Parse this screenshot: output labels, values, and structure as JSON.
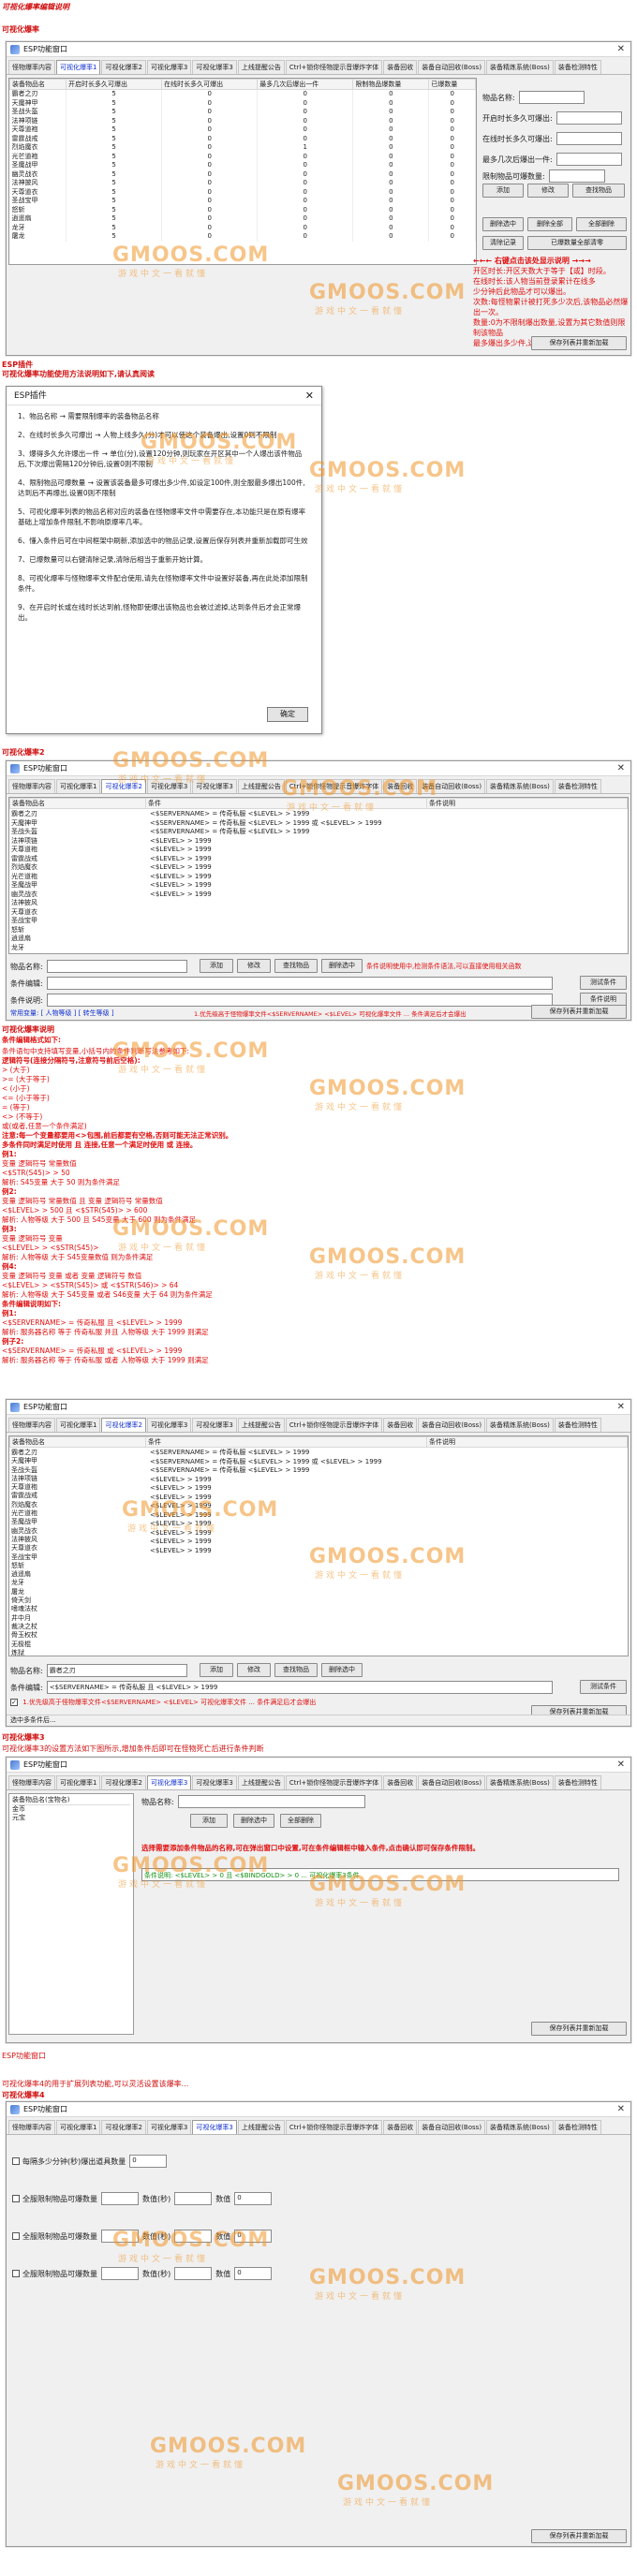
{
  "page_title": "可视化爆率编辑说明",
  "s1": {
    "label": "可视化爆率",
    "window_title": "ESP功能窗口",
    "tabs": [
      "怪物爆率内容",
      "可视化爆率1",
      "可视化爆率2",
      "可视化爆率3",
      "可视化爆率3",
      "上线提醒公告",
      "Ctrl+锁你怪物提示音爆炸字体",
      "装备回收",
      "装备自动回收(Boss)",
      "装备精炼系统(Boss)",
      "装备检测特性"
    ],
    "active_tab": 1,
    "grid_headers": [
      "装备物品名",
      "开启时长多久可爆出",
      "在线时长多久可爆出",
      "最多几次后爆出一件",
      "限制物品爆数量",
      "已爆数量"
    ],
    "grid_rows": [
      [
        "霸者之刃",
        "5",
        "0",
        "0",
        "0",
        "0"
      ],
      [
        "天魔神甲",
        "5",
        "0",
        "0",
        "0",
        "0"
      ],
      [
        "圣战头盔",
        "5",
        "0",
        "0",
        "0",
        "0"
      ],
      [
        "法神项链",
        "5",
        "0",
        "0",
        "0",
        "0"
      ],
      [
        "天尊道袍",
        "5",
        "0",
        "0",
        "0",
        "0"
      ],
      [
        "雷霆战戒",
        "5",
        "0",
        "0",
        "0",
        "0"
      ],
      [
        "烈焰魔衣",
        "5",
        "0",
        "1",
        "0",
        "0"
      ],
      [
        "光芒道袍",
        "5",
        "0",
        "0",
        "0",
        "0"
      ],
      [
        "圣魔战甲",
        "5",
        "0",
        "0",
        "0",
        "0"
      ],
      [
        "幽灵战衣",
        "5",
        "0",
        "0",
        "0",
        "0"
      ],
      [
        "法神披风",
        "5",
        "0",
        "0",
        "0",
        "0"
      ],
      [
        "天尊道衣",
        "5",
        "0",
        "0",
        "0",
        "0"
      ],
      [
        "圣战宝甲",
        "5",
        "0",
        "0",
        "0",
        "0"
      ],
      [
        "怒斩",
        "5",
        "0",
        "0",
        "0",
        "0"
      ],
      [
        "逍遥扇",
        "5",
        "0",
        "0",
        "0",
        "0"
      ],
      [
        "龙牙",
        "5",
        "0",
        "0",
        "0",
        "0"
      ],
      [
        "屠龙",
        "5",
        "0",
        "0",
        "0",
        "0"
      ]
    ],
    "form_labels": [
      "物品名称:",
      "开启时长多久可爆出:",
      "在线时长多久可爆出:",
      "最多几次后爆出一件:",
      "限制物品可爆数量:"
    ],
    "buttons": {
      "add": "添加",
      "modify": "修改",
      "query": "查找物品",
      "delete_selected": "删除选中",
      "delete_all": "删除全部",
      "full_delete": "全部删除",
      "clear_record": "清除记录",
      "clear_all": "已爆数量全部清零",
      "save": "保存列表并重新加载"
    },
    "notes": [
      "←←← 右键点击该处显示说明 →→→",
      "开区时长:开区天数大于等于【或】时段。",
      "在线时长:该人物当前登录累计在线多",
      "少分钟后此物品才可以爆出。",
      "次数:每怪物累计被打死多少次后,该物品必然爆出一次。",
      "数量:0为不限制爆出数量,设置为其它数值则限制该物品",
      "最多爆出多少件,达到数量后不再爆出。"
    ]
  },
  "s2": {
    "label": "ESP插件",
    "note": "可视化爆率功能使用方法说明如下,请认真阅读",
    "popup_title": "ESP插件",
    "popup_paras": [
      "1、物品名称 → 需要限制爆率的装备物品名称",
      "2、在线时长多久可爆出 → 人物上线多久(分)才可以使这个装备爆出,设置0则不限制",
      "3、爆得多久允许爆出一件 → 单位(分),设置120分钟,则玩家在开区其中一个人爆出该件物品后,下次爆出需隔120分钟后,设置0则不限制",
      "4、限制物品可爆数量 → 设置该装备最多可爆出多少件,如设定100件,则全服最多爆出100件,达到后不再爆出,设置0则不限制",
      "5、可视化爆率列表的物品名称对应的装备在怪物爆率文件中需要存在,本功能只是在原有爆率基础上增加条件限制,不影响原爆率几率。",
      "6、懂入条件后可在中间框架中刷新,添加选中的物品记录,设置后保存列表并重新加载即可生效",
      "7、已爆数量可以右键清除记录,清除后相当于重新开始计算。",
      "8、可视化爆率与怪物爆率文件配合使用,请先在怪物爆率文件中设置好装备,再在此处添加限制条件。",
      "9、在开启时长或在线时长达到前,怪物即使爆出该物品也会被过滤掉,达到条件后才会正常爆出。"
    ],
    "ok": "确定"
  },
  "s3": {
    "label": "可视化爆率2",
    "window_title": "ESP功能窗口",
    "active_tab": 2,
    "grid_headers": [
      "装备物品名",
      "条件",
      "条件说明"
    ],
    "left_items": [
      "霸者之刃",
      "天魔神甲",
      "圣战头盔",
      "法神项链",
      "天尊道袍",
      "雷霆战戒",
      "烈焰魔衣",
      "光芒道袍",
      "圣魔战甲",
      "幽灵战衣",
      "法神披风",
      "天尊道衣",
      "圣战宝甲",
      "怒斩",
      "逍遥扇",
      "龙牙"
    ],
    "cond_lines": [
      "<$SERVERNAME> = 传奇私服 <$LEVEL> > 1999",
      "<$SERVERNAME> = 传奇私服 <$LEVEL> > 1999 或 <$LEVEL> > 1999",
      "<$SERVERNAME> = 传奇私服 <$LEVEL> > 1999",
      "<$LEVEL> > 1999",
      "<$LEVEL> > 1999",
      "<$LEVEL> > 1999",
      "<$LEVEL> > 1999",
      "<$LEVEL> > 1999",
      "<$LEVEL> > 1999",
      "<$LEVEL> > 1999"
    ],
    "item_label": "物品名称:",
    "cond_label": "条件编辑:",
    "desc_label": "条件说明:",
    "btn_add": "添加",
    "btn_modify": "修改",
    "btn_query": "查找物品",
    "btn_delete": "删除选中",
    "btn_test": "测试条件",
    "btn_cond": "条件说明",
    "btn_save": "保存列表并重新加载",
    "tip1": "条件说明使用中,检测条件语法,可以直接使用相关函数",
    "var_label": "常用变量: [ 人物等级 ] [ 转生等级 ]",
    "bottom_tip": "1.优先级高于怪物爆率文件<$SERVERNAME> <$LEVEL> 可视化爆率文件 ... 条件满足后才会爆出"
  },
  "s4": {
    "label": "可视化爆率说明",
    "intro": "条件编辑格式如下:",
    "lines": [
      "条件语句中支持填写变量,小括号内的条件判断写法参考如下:",
      "逻辑符号(连接分隔符号,注意符号前后空格):",
      "> (大于)",
      ">= (大于等于)",
      "< (小于)",
      "<= (小于等于)",
      "= (等于)",
      "<> (不等于)",
      "或(或者,任意一个条件满足)",
      "注意:每一个变量都要用<>包围,前后都要有空格,否则可能无法正常识别。",
      "多条件同时满足时使用 且 连接,任意一个满足时使用 或 连接。",
      "例1:",
      "变量 逻辑符号 常量数值",
      "<$STR(S45)> > 50",
      "解析: S45变量 大于 50 则为条件满足",
      "例2:",
      "变量 逻辑符号 常量数值 且 变量 逻辑符号 常量数值",
      "<$LEVEL> > 500 且 <$STR(S45)> > 600",
      "解析: 人物等级 大于 500 且 S45变量 大于 600 则为条件满足",
      "例3:",
      "变量 逻辑符号 变量",
      "<$LEVEL> > <$STR(S45)>",
      "解析: 人物等级 大于 S45变量数值 则为条件满足",
      "例4:",
      "变量 逻辑符号 变量 或者 变量 逻辑符号 数值",
      "<$LEVEL> > <$STR(S45)> 或 <$STR(S46)> > 64",
      "解析: 人物等级 大于 S45变量 或者 S46变量 大于 64 则为条件满足",
      "条件编辑说明如下:",
      "例1:",
      "<$SERVERNAME> = 传奇私服 且 <$LEVEL> > 1999",
      "解析: 服务器名称 等于 传奇私服 并且 人物等级 大于 1999 则满足",
      "例子2:",
      "<$SERVERNAME> = 传奇私服 或 <$LEVEL> > 1999",
      "解析: 服务器名称 等于 传奇私服 或者 人物等级 大于 1999 则满足"
    ]
  },
  "s5": {
    "window_title": "ESP功能窗口",
    "active_tab": 2,
    "left_items": [
      "霸者之刃",
      "天魔神甲",
      "圣战头盔",
      "法神项链",
      "天尊道袍",
      "雷霆战戒",
      "烈焰魔衣",
      "光芒道袍",
      "圣魔战甲",
      "幽灵战衣",
      "法神披风",
      "天尊道衣",
      "圣战宝甲",
      "怒斩",
      "逍遥扇",
      "龙牙",
      "屠龙",
      "倚天剑",
      "嗜魂法杖",
      "井中月",
      "裁决之杖",
      "骨玉权杖",
      "无极棍",
      "炼狱"
    ],
    "cond_lines": [
      "<$SERVERNAME> = 传奇私服 <$LEVEL> > 1999",
      "<$SERVERNAME> = 传奇私服 <$LEVEL> > 1999 或 <$LEVEL> > 1999",
      "<$SERVERNAME> = 传奇私服 <$LEVEL> > 1999",
      "<$LEVEL> > 1999",
      "<$LEVEL> > 1999",
      "<$LEVEL> > 1999",
      "<$LEVEL> > 1999",
      "<$LEVEL> > 1999",
      "<$LEVEL> > 1999",
      "<$LEVEL> > 1999",
      "<$LEVEL> > 1999",
      "<$LEVEL> > 1999"
    ],
    "item_value": "霸者之刃",
    "cond_value": "<$SERVERNAME> = 传奇私服 且 <$LEVEL> > 1999",
    "btn_add": "添加",
    "btn_modify": "修改",
    "btn_query": "查找物品",
    "btn_delete": "删除选中",
    "btn_test": "测试条件",
    "btn_save": "保存列表并重新加载",
    "status": "选中多条件后..."
  },
  "s6": {
    "label": "可视化爆率3",
    "note": "可视化爆率3的设置方法如下图所示,增加条件后即可在怪物死亡后进行条件判断",
    "window_title": "ESP功能窗口",
    "active_tab": 3,
    "list_header": "装备物品名(宝物名)",
    "list_items": [
      "金币",
      "元宝"
    ],
    "item_label": "物品名称:",
    "btn_add": "添加",
    "btn_delete": "删除选中",
    "btn_clear": "全部删除",
    "red_note": "选择需要添加条件物品的名称,可在弹出窗口中设置,可在条件编辑框中输入条件,点击确认即可保存条件限制。",
    "green_note": "条件说明: <$LEVEL> > 0 且 <$BINDGOLD> > 0 ... 可视化爆率3条件",
    "btn_save": "保存列表并重新加载"
  },
  "s7": {
    "label": "ESP功能窗口",
    "note1": "可视化爆率4的用于扩展列表功能,可以灵活设置该爆率...",
    "note2": "可视化爆率4",
    "window_title": "ESP功能窗口",
    "active_tab": 4,
    "rows": [
      {
        "check": "每隔多少分钟(秒)爆出道具数量",
        "val": "0"
      },
      {
        "check": "全服限制物品可爆数量",
        "sub1": "数值(秒)",
        "sub2": "数值",
        "val": "0"
      },
      {
        "check": "全服限制物品可爆数量",
        "sub1": "数值(秒)",
        "sub2": "数值",
        "val": "0"
      },
      {
        "check": "全服限制物品可爆数量",
        "sub1": "数值(秒)",
        "sub2": "数值",
        "val": "0"
      }
    ],
    "btn_save": "保存列表并重新加载"
  },
  "watermark": {
    "brand": "GMOOS.COM",
    "slogan": "游戏中文一看就懂"
  }
}
